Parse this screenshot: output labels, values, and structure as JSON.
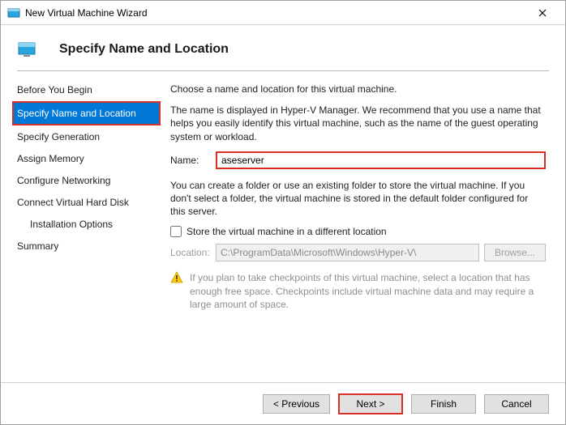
{
  "window": {
    "title": "New Virtual Machine Wizard"
  },
  "header": {
    "title": "Specify Name and Location"
  },
  "sidebar": {
    "items": [
      "Before You Begin",
      "Specify Name and Location",
      "Specify Generation",
      "Assign Memory",
      "Configure Networking",
      "Connect Virtual Hard Disk",
      "Installation Options",
      "Summary"
    ]
  },
  "main": {
    "intro": "Choose a name and location for this virtual machine.",
    "desc": "The name is displayed in Hyper-V Manager. We recommend that you use a name that helps you easily identify this virtual machine, such as the name of the guest operating system or workload.",
    "name_label": "Name:",
    "name_value": "aseserver",
    "folder_desc": "You can create a folder or use an existing folder to store the virtual machine. If you don't select a folder, the virtual machine is stored in the default folder configured for this server.",
    "checkbox_label": "Store the virtual machine in a different location",
    "location_label": "Location:",
    "location_value": "C:\\ProgramData\\Microsoft\\Windows\\Hyper-V\\",
    "browse_label": "Browse...",
    "info_text": "If you plan to take checkpoints of this virtual machine, select a location that has enough free space. Checkpoints include virtual machine data and may require a large amount of space."
  },
  "footer": {
    "previous": "< Previous",
    "next": "Next >",
    "finish": "Finish",
    "cancel": "Cancel"
  }
}
